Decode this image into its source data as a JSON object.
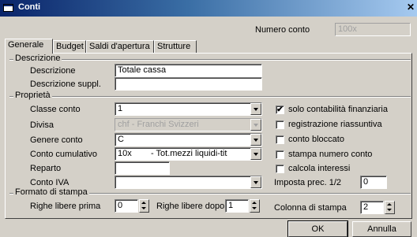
{
  "window": {
    "title": "Conti",
    "close_glyph": "✕"
  },
  "header": {
    "numero_conto_label": "Numero conto",
    "numero_conto_value": "100x"
  },
  "tabs": [
    "Generale",
    "Budget",
    "Saldi d'apertura",
    "Strutture"
  ],
  "descrizione": {
    "group_title": "Descrizione",
    "descrizione_label": "Descrizione",
    "descrizione_value": "Totale cassa",
    "suppl_label": "Descrizione suppl.",
    "suppl_value": ""
  },
  "proprieta": {
    "group_title": "Proprietà",
    "classe_label": "Classe conto",
    "classe_value": "1",
    "divisa_label": "Divisa",
    "divisa_value": "chf - Franchi Svizzeri",
    "genere_label": "Genere conto",
    "genere_value": "C",
    "cumulativo_label": "Conto cumulativo",
    "cumulativo_code": "10x",
    "cumulativo_desc": "- Tot.mezzi liquidi-tit",
    "reparto_label": "Reparto",
    "reparto_value": "",
    "iva_label": "Conto IVA",
    "iva_value": "",
    "checkboxes": [
      {
        "label": "solo contabilità finanziaria",
        "checked": true
      },
      {
        "label": "registrazione riassuntiva",
        "checked": false
      },
      {
        "label": "conto bloccato",
        "checked": false
      },
      {
        "label": "stampa numero conto",
        "checked": false
      },
      {
        "label": "calcola interessi",
        "checked": false
      }
    ],
    "imposta_label": "Imposta prec. 1/2",
    "imposta_value": "0"
  },
  "formato": {
    "group_title": "Formato di stampa",
    "righe_prima_label": "Righe libere prima",
    "righe_prima_value": "0",
    "righe_dopo_label": "Righe libere dopo",
    "righe_dopo_value": "1",
    "colonna_label": "Colonna di stampa",
    "colonna_value": "2"
  },
  "buttons": {
    "ok": "OK",
    "annulla": "Annulla"
  },
  "colors": {
    "title_start": "#0a246a",
    "title_end": "#a6caf0",
    "face": "#d4d0c8"
  }
}
